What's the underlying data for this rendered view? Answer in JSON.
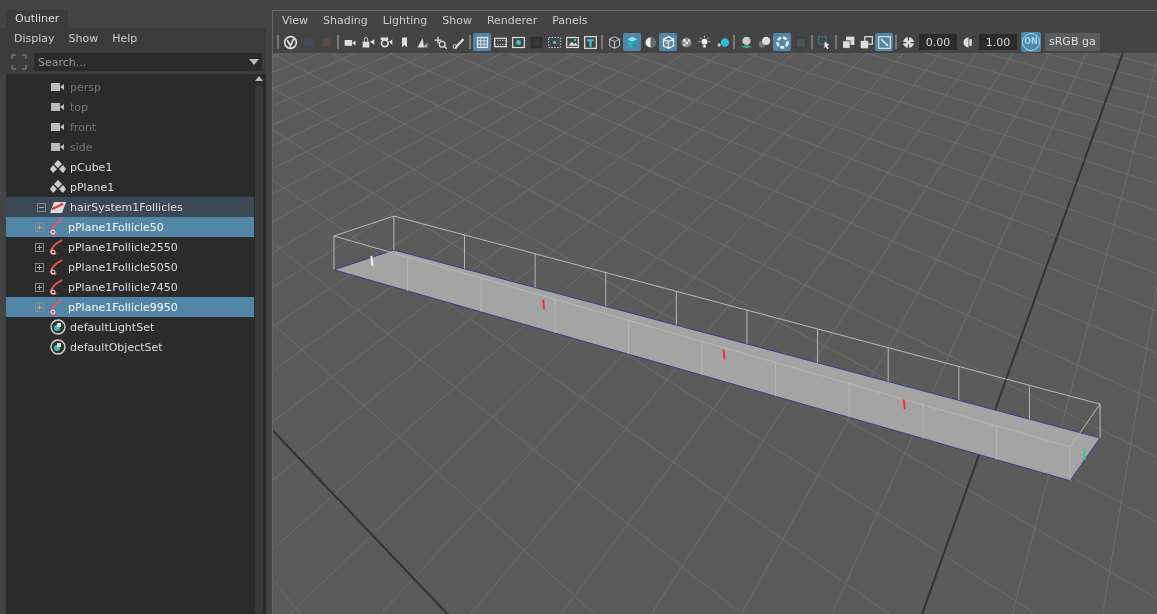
{
  "outliner": {
    "tab": "Outliner",
    "menu": [
      "Display",
      "Show",
      "Help"
    ],
    "search": {
      "placeholder": "Search..."
    },
    "items": [
      {
        "label": "persp",
        "kind": "camera",
        "dimmed": true,
        "selected": false,
        "highlighted": false
      },
      {
        "label": "top",
        "kind": "camera",
        "dimmed": true,
        "selected": false,
        "highlighted": false
      },
      {
        "label": "front",
        "kind": "camera",
        "dimmed": true,
        "selected": false,
        "highlighted": false
      },
      {
        "label": "side",
        "kind": "camera",
        "dimmed": true,
        "selected": false,
        "highlighted": false
      },
      {
        "label": "pCube1",
        "kind": "mesh",
        "dimmed": false,
        "selected": false,
        "highlighted": false
      },
      {
        "label": "pPlane1",
        "kind": "mesh",
        "dimmed": false,
        "selected": false,
        "highlighted": false
      },
      {
        "label": "hairSystem1Follicles",
        "kind": "hair-system",
        "dimmed": false,
        "selected": false,
        "highlighted": true,
        "expanded": true,
        "children": [
          {
            "label": "pPlane1Follicle50",
            "kind": "follicle",
            "dimmed": false,
            "selected": true,
            "expanded": false
          },
          {
            "label": "pPlane1Follicle2550",
            "kind": "follicle",
            "dimmed": false,
            "selected": false,
            "expanded": false
          },
          {
            "label": "pPlane1Follicle5050",
            "kind": "follicle",
            "dimmed": false,
            "selected": false,
            "expanded": false
          },
          {
            "label": "pPlane1Follicle7450",
            "kind": "follicle",
            "dimmed": false,
            "selected": false,
            "expanded": false
          },
          {
            "label": "pPlane1Follicle9950",
            "kind": "follicle",
            "dimmed": false,
            "selected": true,
            "expanded": false
          }
        ]
      },
      {
        "label": "defaultLightSet",
        "kind": "set",
        "dimmed": false,
        "selected": false,
        "highlighted": false
      },
      {
        "label": "defaultObjectSet",
        "kind": "set",
        "dimmed": false,
        "selected": false,
        "highlighted": false
      }
    ]
  },
  "viewport": {
    "menu": [
      "View",
      "Shading",
      "Lighting",
      "Show",
      "Renderer",
      "Panels"
    ],
    "toolbar": {
      "groups": [
        [
          {
            "pressed": false
          },
          {
            "pressed": false
          },
          {
            "pressed": false
          }
        ],
        [
          {
            "pressed": false
          },
          {
            "pressed": false
          },
          {
            "pressed": false
          },
          {
            "pressed": false
          },
          {
            "pressed": false
          },
          {
            "pressed": false
          },
          {
            "pressed": false
          }
        ],
        [
          {
            "pressed": true
          },
          {
            "pressed": false
          },
          {
            "pressed": false
          },
          {
            "pressed": false
          },
          {
            "pressed": false
          },
          {
            "pressed": false
          },
          {
            "pressed": false
          }
        ],
        [
          {
            "pressed": false
          },
          {
            "pressed": true
          },
          {
            "pressed": false
          },
          {
            "pressed": true
          },
          {
            "pressed": false
          },
          {
            "pressed": false
          },
          {
            "pressed": false
          }
        ],
        [
          {
            "pressed": false
          },
          {
            "pressed": false
          },
          {
            "pressed": true
          },
          {
            "pressed": false
          }
        ],
        [
          {
            "pressed": false
          }
        ],
        [
          {
            "pressed": false
          },
          {
            "pressed": false
          },
          {
            "pressed": true
          }
        ]
      ],
      "exposure": "0.00",
      "gamma": "1.00",
      "color_management": {
        "label": "ON",
        "on": true
      },
      "view_transform": "sRGB ga"
    }
  }
}
